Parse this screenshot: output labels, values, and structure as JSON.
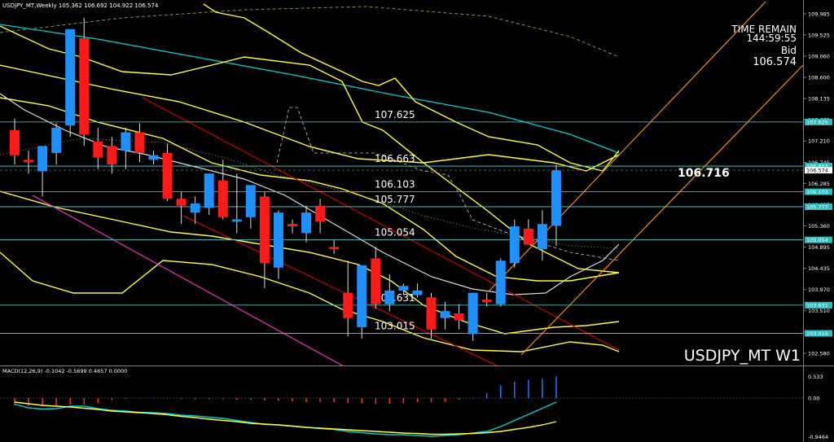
{
  "header": {
    "info_line": "USDJPY_MT,Weekly  105.362 106.692 104.922 106.574",
    "macd_line": "MACD(12,26,9) -0.1042 -0.5699 0.4657 0.0000"
  },
  "timer": {
    "title": "TIME REMAIN",
    "countdown": "144:59:55",
    "bid_label": "Bid",
    "bid_value": "106.574"
  },
  "watermark": "USDJPY_MT W1",
  "price_callout": "106.716",
  "colors": {
    "background": "#000000",
    "bull": "#1e90ff",
    "bear": "#ff1a1a",
    "bands": "#ffff33",
    "cyan": "#00cccc",
    "channel_red": "#d40000",
    "channel_orange": "#ff9900",
    "magenta": "#ff33cc",
    "macd_hist_pos": "#1e78ff",
    "macd_hist_neg": "#ff2a2a"
  },
  "chart_data": {
    "type": "candlestick",
    "price_axis_ticks": [
      "109.985",
      "109.525",
      "109.060",
      "108.600",
      "108.135",
      "107.675",
      "107.210",
      "106.745",
      "106.285",
      "105.825",
      "105.360",
      "104.895",
      "104.435",
      "103.970",
      "103.510",
      "103.045",
      "102.580"
    ],
    "ylim": [
      102.35,
      110.25
    ],
    "horizontal_levels": [
      {
        "value": 107.625,
        "label": "107.625",
        "tag": "107.625"
      },
      {
        "value": 106.663,
        "label": "106.663",
        "tag": "106.663"
      },
      {
        "value": 106.103,
        "label": "106.103",
        "tag": "106.103"
      },
      {
        "value": 105.777,
        "label": "105.777",
        "tag": "105.777"
      },
      {
        "value": 105.054,
        "label": "105.054",
        "tag": "105.054"
      },
      {
        "value": 103.631,
        "label": "103.631",
        "tag": "103.631"
      },
      {
        "value": 103.015,
        "label": "103.015",
        "tag": "103.015"
      }
    ],
    "current_price_tag": "106.574",
    "candles": [
      {
        "o": 107.45,
        "h": 107.7,
        "l": 106.7,
        "c": 106.9
      },
      {
        "o": 106.8,
        "h": 107.0,
        "l": 106.5,
        "c": 106.75
      },
      {
        "o": 106.55,
        "h": 107.1,
        "l": 106.0,
        "c": 107.1
      },
      {
        "o": 106.95,
        "h": 107.6,
        "l": 106.7,
        "c": 107.5
      },
      {
        "o": 107.55,
        "h": 108.6,
        "l": 107.3,
        "c": 109.65
      },
      {
        "o": 109.45,
        "h": 109.9,
        "l": 107.1,
        "c": 107.35
      },
      {
        "o": 107.2,
        "h": 107.5,
        "l": 106.6,
        "c": 106.85
      },
      {
        "o": 107.1,
        "h": 107.3,
        "l": 106.5,
        "c": 106.7
      },
      {
        "o": 107.0,
        "h": 107.5,
        "l": 106.6,
        "c": 107.4
      },
      {
        "o": 107.4,
        "h": 107.6,
        "l": 106.75,
        "c": 106.95
      },
      {
        "o": 106.8,
        "h": 107.0,
        "l": 106.7,
        "c": 106.9
      },
      {
        "o": 106.95,
        "h": 107.15,
        "l": 105.9,
        "c": 105.95
      },
      {
        "o": 105.95,
        "h": 106.1,
        "l": 105.4,
        "c": 105.8
      },
      {
        "o": 105.65,
        "h": 106.0,
        "l": 105.4,
        "c": 105.85
      },
      {
        "o": 105.75,
        "h": 106.5,
        "l": 105.6,
        "c": 106.5
      },
      {
        "o": 106.35,
        "h": 106.8,
        "l": 105.5,
        "c": 105.55
      },
      {
        "o": 105.45,
        "h": 106.5,
        "l": 105.2,
        "c": 105.5
      },
      {
        "o": 105.55,
        "h": 106.2,
        "l": 105.3,
        "c": 106.25
      },
      {
        "o": 106.0,
        "h": 106.1,
        "l": 104.0,
        "c": 104.55
      },
      {
        "o": 104.45,
        "h": 105.7,
        "l": 104.2,
        "c": 105.65
      },
      {
        "o": 105.4,
        "h": 105.5,
        "l": 105.2,
        "c": 105.35
      },
      {
        "o": 105.2,
        "h": 105.8,
        "l": 105.0,
        "c": 105.65
      },
      {
        "o": 105.8,
        "h": 105.95,
        "l": 105.2,
        "c": 105.45
      },
      {
        "o": 104.9,
        "h": 105.05,
        "l": 104.75,
        "c": 104.85
      },
      {
        "o": 103.9,
        "h": 104.6,
        "l": 102.95,
        "c": 103.35
      },
      {
        "o": 103.15,
        "h": 104.5,
        "l": 102.9,
        "c": 104.5
      },
      {
        "o": 104.65,
        "h": 104.9,
        "l": 103.55,
        "c": 103.65
      },
      {
        "o": 103.65,
        "h": 104.3,
        "l": 103.5,
        "c": 103.95
      },
      {
        "o": 103.95,
        "h": 104.1,
        "l": 103.85,
        "c": 104.05
      },
      {
        "o": 103.85,
        "h": 104.1,
        "l": 103.8,
        "c": 103.95
      },
      {
        "o": 103.8,
        "h": 103.9,
        "l": 102.9,
        "c": 103.1
      },
      {
        "o": 103.35,
        "h": 103.7,
        "l": 103.1,
        "c": 103.5
      },
      {
        "o": 103.45,
        "h": 103.65,
        "l": 103.1,
        "c": 103.3
      },
      {
        "o": 103.0,
        "h": 103.9,
        "l": 102.85,
        "c": 103.9
      },
      {
        "o": 103.75,
        "h": 103.9,
        "l": 103.6,
        "c": 103.7
      },
      {
        "o": 103.65,
        "h": 104.65,
        "l": 103.6,
        "c": 104.6
      },
      {
        "o": 104.55,
        "h": 105.5,
        "l": 104.45,
        "c": 105.35
      },
      {
        "o": 105.3,
        "h": 105.5,
        "l": 104.95,
        "c": 104.95
      },
      {
        "o": 104.85,
        "h": 105.7,
        "l": 104.6,
        "c": 105.4
      },
      {
        "o": 105.36,
        "h": 106.69,
        "l": 104.92,
        "c": 106.57
      }
    ],
    "macd": {
      "axis_ticks": [
        "0.533",
        "0.00",
        "-0.9464"
      ],
      "ylim": [
        -0.98,
        0.58
      ],
      "histogram": [
        -0.18,
        -0.2,
        -0.2,
        -0.19,
        -0.16,
        -0.16,
        -0.12,
        -0.05,
        -0.02,
        -0.01,
        0.01,
        -0.01,
        -0.02,
        -0.03,
        -0.03,
        -0.03,
        -0.04,
        -0.05,
        -0.06,
        -0.07,
        -0.08,
        -0.1,
        -0.1,
        -0.1,
        -0.12,
        -0.12,
        -0.15,
        -0.14,
        -0.13,
        -0.1,
        -0.1,
        -0.08,
        -0.04,
        0.01,
        0.12,
        0.3,
        0.4,
        0.45,
        0.47,
        0.53
      ],
      "macd_line": [
        -0.15,
        -0.24,
        -0.27,
        -0.26,
        -0.2,
        -0.2,
        -0.26,
        -0.3,
        -0.32,
        -0.35,
        -0.36,
        -0.38,
        -0.42,
        -0.44,
        -0.47,
        -0.5,
        -0.55,
        -0.6,
        -0.65,
        -0.66,
        -0.69,
        -0.72,
        -0.75,
        -0.77,
        -0.82,
        -0.85,
        -0.88,
        -0.9,
        -0.9,
        -0.92,
        -0.94,
        -0.92,
        -0.9,
        -0.86,
        -0.82,
        -0.7,
        -0.55,
        -0.4,
        -0.25,
        -0.1
      ],
      "signal_line": [
        -0.1,
        -0.14,
        -0.18,
        -0.2,
        -0.22,
        -0.25,
        -0.28,
        -0.32,
        -0.34,
        -0.36,
        -0.38,
        -0.41,
        -0.45,
        -0.48,
        -0.52,
        -0.55,
        -0.58,
        -0.62,
        -0.64,
        -0.66,
        -0.69,
        -0.72,
        -0.74,
        -0.76,
        -0.78,
        -0.8,
        -0.82,
        -0.84,
        -0.86,
        -0.87,
        -0.89,
        -0.89,
        -0.88,
        -0.87,
        -0.85,
        -0.82,
        -0.77,
        -0.72,
        -0.66,
        -0.58
      ]
    }
  }
}
